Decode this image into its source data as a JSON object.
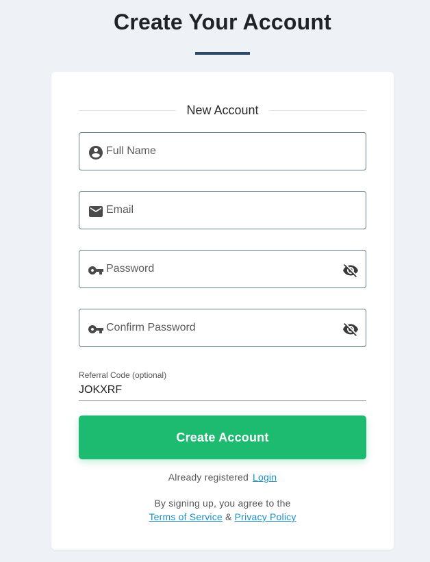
{
  "page": {
    "title": "Create Your Account"
  },
  "form": {
    "section_label": "New Account",
    "full_name": {
      "placeholder": "Full Name",
      "value": ""
    },
    "email": {
      "placeholder": "Email",
      "value": ""
    },
    "password": {
      "placeholder": "Password",
      "value": ""
    },
    "confirm_password": {
      "placeholder": "Confirm Password",
      "value": ""
    },
    "referral": {
      "label": "Referral Code (optional)",
      "value": "JOKXRF"
    },
    "submit_label": "Create Account"
  },
  "footer": {
    "already_registered": "Already registered",
    "login_link": "Login",
    "agree_text": "By signing up, you agree to the",
    "terms_link": "Terms of Service",
    "ampersand": "&",
    "privacy_link": "Privacy Policy"
  },
  "icons": {
    "full_name": "account-circle-icon",
    "email": "email-icon",
    "password": "key-icon",
    "confirm_password": "key-icon",
    "password_toggle": "visibility-off-icon",
    "confirm_toggle": "visibility-off-icon"
  },
  "colors": {
    "background": "#eef2f6",
    "accent_underline": "#2c4a66",
    "button": "#1dbb6f",
    "link": "#1a8fc4",
    "field_border": "#5f7f8d"
  }
}
